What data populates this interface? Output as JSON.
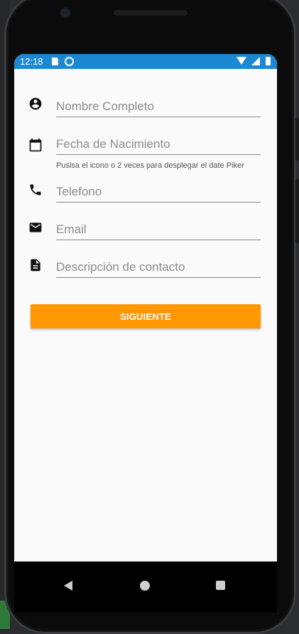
{
  "status_bar": {
    "time": "12:18",
    "background": "#1d88d2"
  },
  "form": {
    "fields": [
      {
        "icon": "account-circle-icon",
        "placeholder": "Nombre Completo"
      },
      {
        "icon": "calendar-icon",
        "placeholder": "Fecha de Nacimiento"
      },
      {
        "icon": "phone-icon",
        "placeholder": "Telefono"
      },
      {
        "icon": "email-icon",
        "placeholder": "Email"
      },
      {
        "icon": "document-icon",
        "placeholder": "Descripción de contacto"
      }
    ],
    "date_hint": "Puslsa el icono o 2 veces para desplegar el date Piker",
    "submit_label": "SIGUIENTE",
    "submit_color": "#ff9800"
  },
  "navigation": {
    "back": "back-icon",
    "home": "home-icon",
    "recents": "recents-icon"
  }
}
